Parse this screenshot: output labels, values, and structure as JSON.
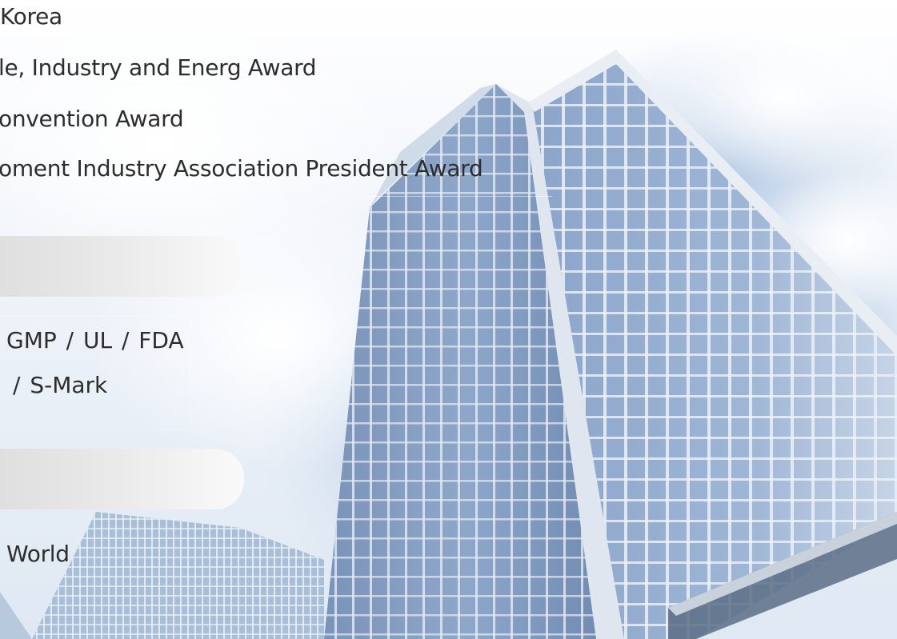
{
  "awards": [
    "Korea",
    "le, Industry and Energ Award",
    "onvention Award",
    "oment Industry Association President Award"
  ],
  "certifications": [
    "GMP  /  UL  /  FDA",
    "/  S-Mark"
  ],
  "world_label": "World"
}
